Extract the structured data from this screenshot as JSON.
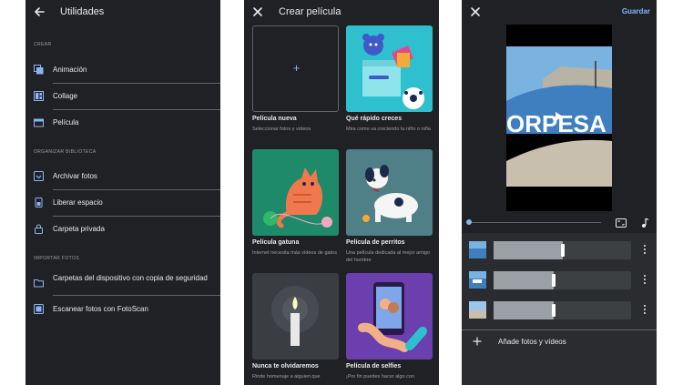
{
  "utilities_screen": {
    "title": "Utilidades",
    "sections": [
      {
        "label": "CREAR",
        "items": [
          {
            "label": "Animación",
            "icon": "animation-icon"
          },
          {
            "label": "Collage",
            "icon": "collage-icon"
          },
          {
            "label": "Película",
            "icon": "movie-icon"
          }
        ]
      },
      {
        "label": "ORGANIZAR BIBLIOTECA",
        "items": [
          {
            "label": "Archivar fotos",
            "icon": "archive-icon"
          },
          {
            "label": "Liberar espacio",
            "icon": "free-space-icon"
          },
          {
            "label": "Carpeta privada",
            "icon": "lock-icon"
          }
        ]
      },
      {
        "label": "IMPORTAR FOTOS",
        "items": [
          {
            "label": "Carpetas del dispositivo con copia de seguridad",
            "icon": "folder-icon"
          },
          {
            "label": "Escanear fotos con FotoScan",
            "icon": "photoscan-icon"
          }
        ]
      }
    ]
  },
  "create_movie_screen": {
    "title": "Crear película",
    "cards": [
      {
        "title": "Película nueva",
        "subtitle": "Seleccionar fotos y vídeos",
        "icon": "plus-icon"
      },
      {
        "title": "Qué rápido creces",
        "subtitle": "Mira como va creciendo tu niño o niña",
        "icon": "toys-illustration"
      },
      {
        "title": "Película gatuna",
        "subtitle": "Internet necesita más vídeos de gatos",
        "icon": "cat-illustration"
      },
      {
        "title": "Película de perritos",
        "subtitle": "Una película dedicada al mejor amigo del hombre",
        "icon": "dog-illustration"
      },
      {
        "title": "Nunca te olvidaremos",
        "subtitle": "Rinde homenaje a alguien que",
        "icon": "candle-illustration"
      },
      {
        "title": "Película de selfies",
        "subtitle": "¡Por fin puedes hacer algo con",
        "icon": "selfie-illustration"
      }
    ]
  },
  "editor_screen": {
    "save_label": "Guardar",
    "preview_wall_text": "ORPESA",
    "clips": [
      {
        "trim_fraction": 0.5
      },
      {
        "trim_fraction": 0.44
      },
      {
        "trim_fraction": 0.44
      }
    ],
    "add_label": "Añade fotos y vídeos"
  },
  "colors": {
    "background": "#202124",
    "panel": "#2b2c30",
    "accent": "#8ab4f8",
    "text": "#e8eaed",
    "muted": "#9aa0a6"
  }
}
